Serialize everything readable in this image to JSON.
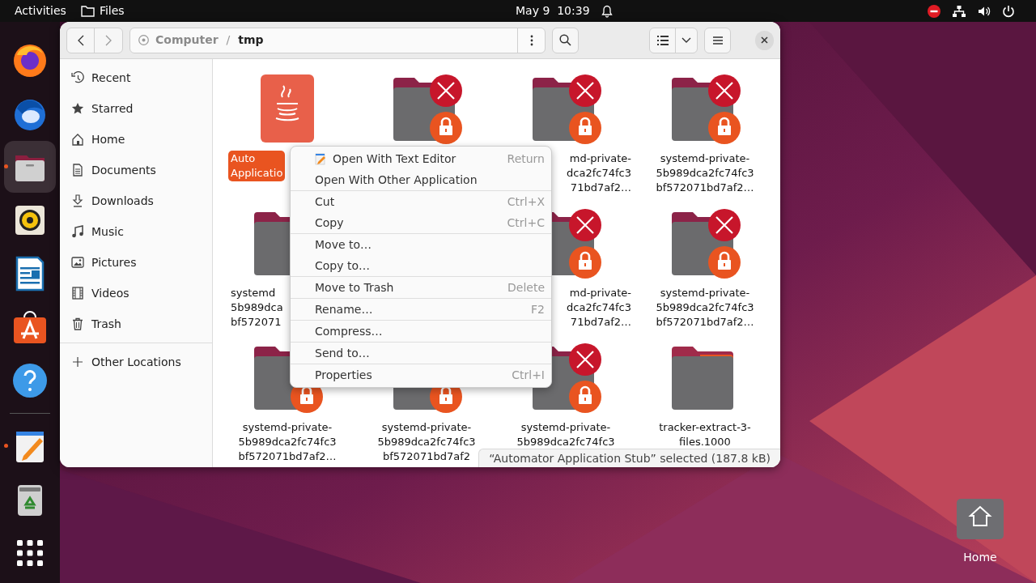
{
  "top_bar": {
    "activities": "Activities",
    "app_name": "Files",
    "clock": "May 9  10:39"
  },
  "dock": [
    {
      "kind": "firefox",
      "running": false,
      "selected": false
    },
    {
      "kind": "thunderbird",
      "running": false,
      "selected": false
    },
    {
      "kind": "files",
      "running": true,
      "selected": true
    },
    {
      "kind": "rhythmbox",
      "running": false,
      "selected": false
    },
    {
      "kind": "writer",
      "running": false,
      "selected": false
    },
    {
      "kind": "appcenter",
      "running": false,
      "selected": false
    },
    {
      "kind": "help",
      "running": false,
      "selected": false
    },
    {
      "kind": "separator"
    },
    {
      "kind": "texteditor",
      "running": true,
      "selected": false
    },
    {
      "kind": "trash",
      "running": false,
      "selected": false
    },
    {
      "kind": "apps",
      "running": false,
      "selected": false
    }
  ],
  "path": {
    "segments": [
      "Computer",
      "tmp"
    ],
    "separator": "/"
  },
  "sidebar": {
    "items": [
      {
        "kind": "recent",
        "label": "Recent"
      },
      {
        "kind": "star",
        "label": "Starred"
      },
      {
        "kind": "home",
        "label": "Home"
      },
      {
        "kind": "document",
        "label": "Documents"
      },
      {
        "kind": "download",
        "label": "Downloads"
      },
      {
        "kind": "music",
        "label": "Music"
      },
      {
        "kind": "pictures",
        "label": "Pictures"
      },
      {
        "kind": "videos",
        "label": "Videos"
      },
      {
        "kind": "trash",
        "label": "Trash"
      }
    ],
    "other": {
      "kind": "plus",
      "label": "Other Locations"
    }
  },
  "files": [
    {
      "kind": "java",
      "selected": true,
      "label_lines": [
        "Auto",
        "Applicatio"
      ]
    },
    {
      "kind": "folder",
      "selected": false,
      "unreadable": true,
      "locked": true
    },
    {
      "kind": "folder",
      "selected": false,
      "unreadable": true,
      "locked": true,
      "label_lines": [
        "md-private-",
        "dca2fc74fc3",
        "71bd7af2…"
      ]
    },
    {
      "kind": "folder",
      "selected": false,
      "unreadable": true,
      "locked": true,
      "label_lines": [
        "systemd-private-",
        "5b989dca2fc74fc3",
        "bf572071bd7af2…"
      ]
    },
    {
      "kind": "folder",
      "selected": false,
      "label_lines": [
        "systemd",
        "5b989dca",
        "bf572071"
      ]
    },
    {
      "kind": "covered"
    },
    {
      "kind": "folder",
      "selected": false,
      "unreadable": true,
      "locked": true,
      "label_lines": [
        "md-private-",
        "dca2fc74fc3",
        "71bd7af2…"
      ]
    },
    {
      "kind": "folder",
      "selected": false,
      "unreadable": true,
      "locked": true,
      "label_lines": [
        "systemd-private-",
        "5b989dca2fc74fc3",
        "bf572071bd7af2…"
      ]
    },
    {
      "kind": "folder",
      "selected": false,
      "unreadable": false,
      "locked": true,
      "label_lines": [
        "systemd-private-",
        "5b989dca2fc74fc3",
        "bf572071bd7af2…"
      ]
    },
    {
      "kind": "folder",
      "selected": false,
      "unreadable": false,
      "locked": true,
      "label_lines": [
        "systemd-private-",
        "5b989dca2fc74fc3",
        "bf572071bd7af2"
      ]
    },
    {
      "kind": "folder",
      "selected": false,
      "unreadable": true,
      "locked": true,
      "label_lines": [
        "systemd-private-",
        "5b989dca2fc74fc3"
      ]
    },
    {
      "kind": "tracker-folder",
      "selected": false,
      "unreadable": false,
      "locked": false,
      "label_lines": [
        "tracker-extract-3-",
        "files.1000"
      ]
    }
  ],
  "context_menu": {
    "groups": [
      [
        {
          "label": "Open With Text Editor",
          "shortcut": "Return",
          "kind": "texteditor"
        },
        {
          "label": "Open With Other Application"
        }
      ],
      [
        {
          "label": "Cut",
          "shortcut": "Ctrl+X"
        },
        {
          "label": "Copy",
          "shortcut": "Ctrl+C"
        }
      ],
      [
        {
          "label": "Move to…"
        },
        {
          "label": "Copy to…"
        }
      ],
      [
        {
          "label": "Move to Trash",
          "shortcut": "Delete"
        }
      ],
      [
        {
          "label": "Rename…",
          "shortcut": "F2"
        }
      ],
      [
        {
          "label": "Compress…"
        }
      ],
      [
        {
          "label": "Send to…"
        }
      ],
      [
        {
          "label": "Properties",
          "shortcut": "Ctrl+I"
        }
      ]
    ]
  },
  "status_bar": "“Automator Application Stub” selected (187.8 kB)",
  "desktop_icons": [
    {
      "label": "Home"
    }
  ]
}
